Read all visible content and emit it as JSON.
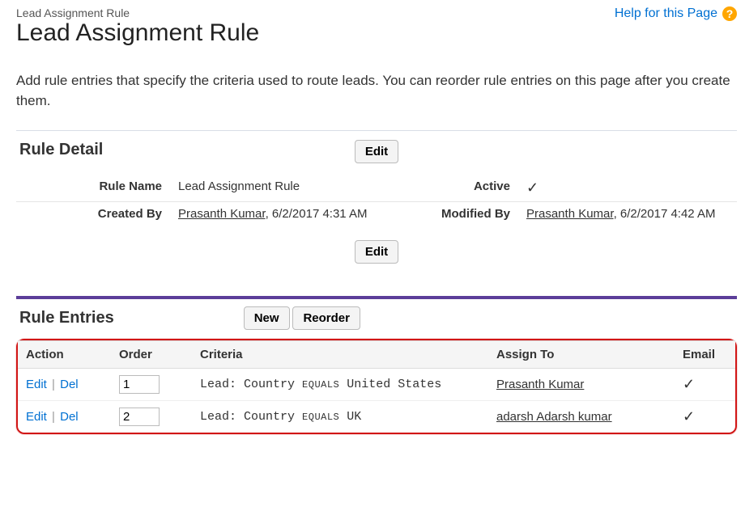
{
  "breadcrumb": "Lead Assignment Rule",
  "pageTitle": "Lead Assignment Rule",
  "helpLink": "Help for this Page",
  "intro": "Add rule entries that specify the criteria used to route leads. You can reorder rule entries on this page after you create them.",
  "ruleDetail": {
    "sectionTitle": "Rule Detail",
    "editButton": "Edit",
    "labels": {
      "ruleName": "Rule Name",
      "active": "Active",
      "createdBy": "Created By",
      "modifiedBy": "Modified By"
    },
    "ruleName": "Lead Assignment Rule",
    "active": true,
    "createdBy": {
      "name": "Prasanth Kumar",
      "date": ", 6/2/2017 4:31 AM"
    },
    "modifiedBy": {
      "name": "Prasanth Kumar",
      "date": ", 6/2/2017 4:42 AM"
    }
  },
  "ruleEntries": {
    "sectionTitle": "Rule Entries",
    "newButton": "New",
    "reorderButton": "Reorder",
    "columns": {
      "action": "Action",
      "order": "Order",
      "criteria": "Criteria",
      "assignTo": "Assign To",
      "email": "Email"
    },
    "actionLabels": {
      "edit": "Edit",
      "del": "Del"
    },
    "rows": [
      {
        "order": "1",
        "criteriaLead": "Lead: Country",
        "criteriaOp": "EQUALS",
        "criteriaValue": " United States",
        "assignTo": "Prasanth Kumar",
        "email": true
      },
      {
        "order": "2",
        "criteriaLead": "Lead: Country",
        "criteriaOp": "EQUALS",
        "criteriaValue": " UK",
        "assignTo": "adarsh Adarsh kumar",
        "email": true
      }
    ]
  }
}
